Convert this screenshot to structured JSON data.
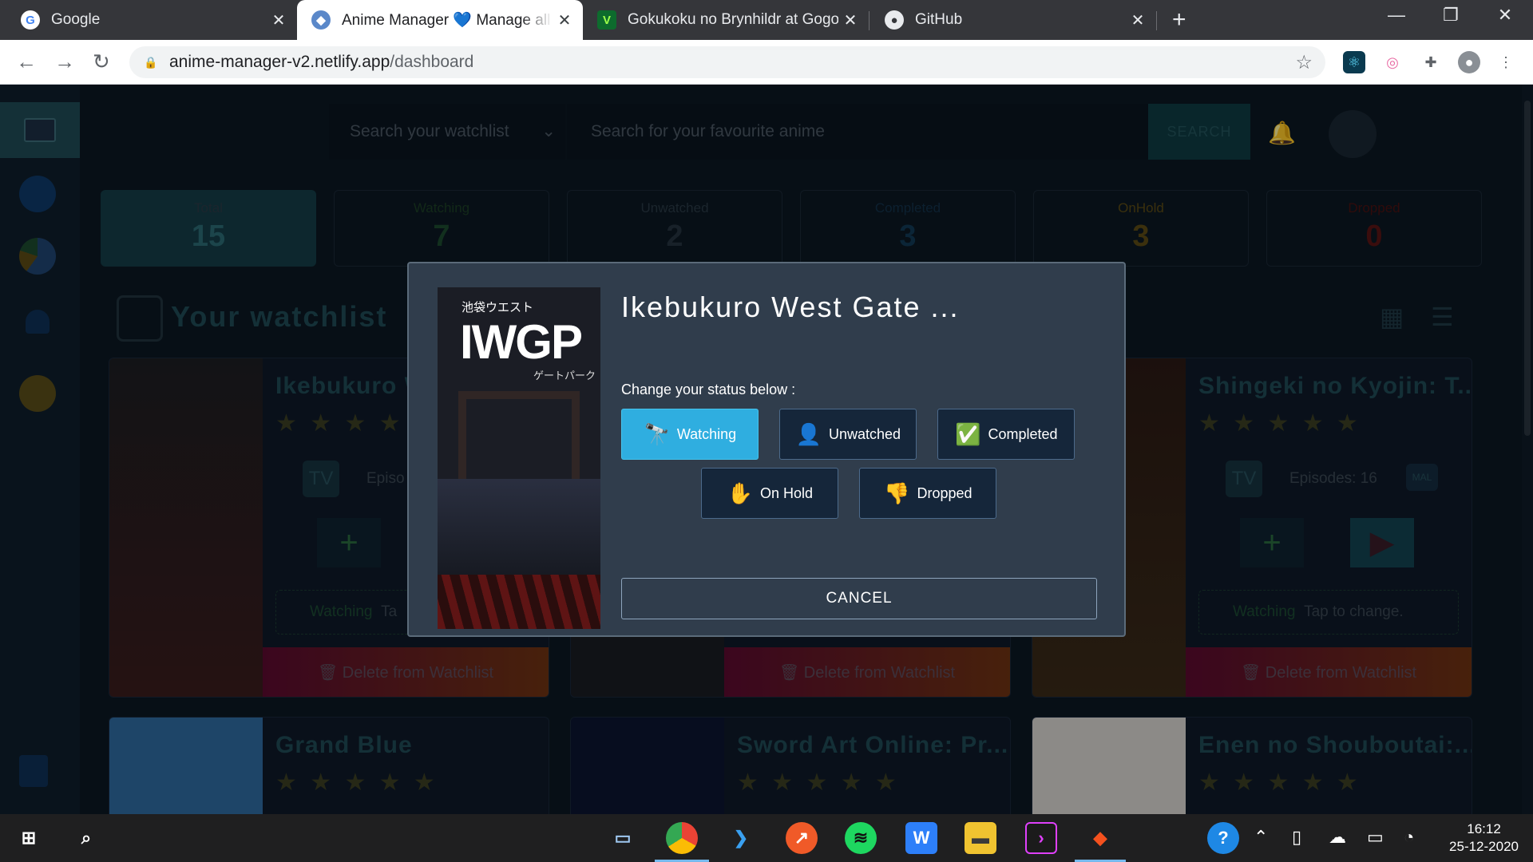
{
  "browser": {
    "tabs": [
      {
        "title": "Google",
        "close": "✕"
      },
      {
        "title": "Anime Manager 💙 Manage all y",
        "close": "✕"
      },
      {
        "title": "Gokukoku no Brynhildr at Gogoa",
        "close": "✕"
      },
      {
        "title": "GitHub",
        "close": "✕"
      }
    ],
    "new_tab": "+",
    "url_domain": "anime-manager-v2.netlify.app",
    "url_path": "/dashboard",
    "window_controls": {
      "minimize": "—",
      "restore": "❐",
      "close": "✕"
    }
  },
  "app": {
    "watchlist_search_placeholder": "Search your watchlist",
    "anime_search_placeholder": "Search for your favourite anime",
    "search_button": "SEARCH",
    "stats": [
      {
        "label": "Total",
        "value": "15",
        "color": "#2b6a73"
      },
      {
        "label": "Watching",
        "value": "7",
        "color": "#1d4b2e"
      },
      {
        "label": "Unwatched",
        "value": "2",
        "color": "#25333f"
      },
      {
        "label": "Completed",
        "value": "3",
        "color": "#123a55"
      },
      {
        "label": "OnHold",
        "value": "3",
        "color": "#5b4b15"
      },
      {
        "label": "Dropped",
        "value": "0",
        "color": "#5a1414"
      }
    ],
    "watchlist_title": "Your watchlist",
    "cards": [
      {
        "title": "Ikebukuro W",
        "badge": "TV",
        "episodes": "Episo",
        "status": "Watching",
        "status_hint": "Ta",
        "delete": "🗑 Delete from Watchlist"
      },
      {
        "title": "",
        "badge": "",
        "episodes": "",
        "status": "",
        "status_hint": "",
        "delete": "🗑 Delete from Watchlist"
      },
      {
        "title": "Shingeki no Kyojin: T...",
        "badge": "TV",
        "episodes": "Episodes: 16",
        "mal": "MAL",
        "status": "Watching",
        "status_hint": "Tap to change.",
        "delete": "🗑 Delete from Watchlist"
      },
      {
        "title": "Grand Blue"
      },
      {
        "title": "Sword Art Online: Pr..."
      },
      {
        "title": "Enen no Shouboutai:..."
      }
    ],
    "stars_full": "★ ★ ★",
    "stars_four": "★ ★ ★ ★",
    "stars_five": "★ ★ ★ ★ ★"
  },
  "modal": {
    "title": "Ikebukuro West Gate ...",
    "poster_jp": "池袋ウエスト",
    "poster_big": "IWGP",
    "poster_sub": "ゲートパーク",
    "prompt": "Change your status below :",
    "buttons": [
      {
        "label": "Watching",
        "icon": "binoculars-icon",
        "selected": true
      },
      {
        "label": "Unwatched",
        "icon": "person-icon",
        "selected": false
      },
      {
        "label": "Completed",
        "icon": "check-person-icon",
        "selected": false
      },
      {
        "label": "On Hold",
        "icon": "hand-icon",
        "selected": false
      },
      {
        "label": "Dropped",
        "icon": "thumbs-down-icon",
        "selected": false
      }
    ],
    "cancel": "CANCEL"
  },
  "taskbar": {
    "time": "16:12",
    "date": "25-12-2020"
  }
}
